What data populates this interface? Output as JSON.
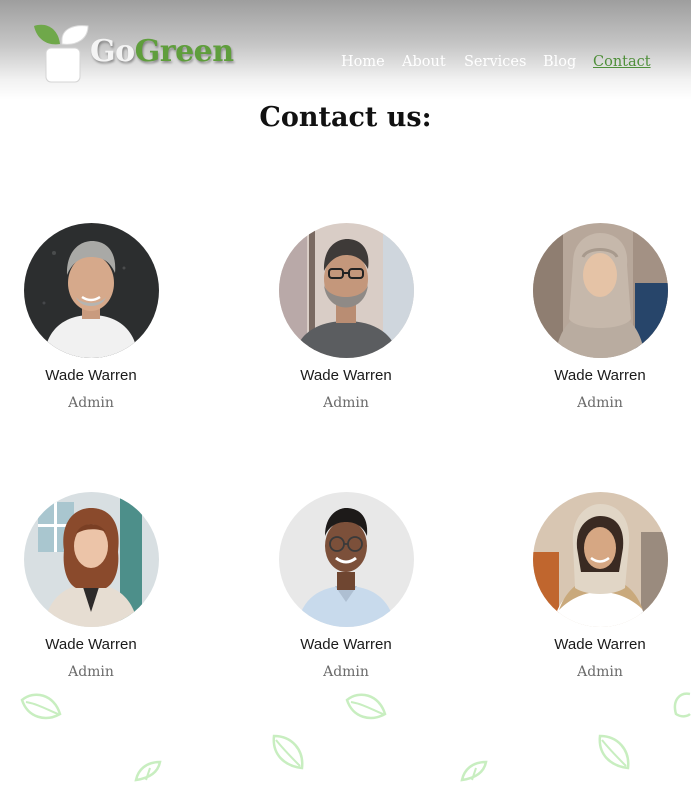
{
  "brand": {
    "name_part1": "Go",
    "name_part2": "Green"
  },
  "nav": {
    "items": [
      {
        "label": "Home",
        "active": false
      },
      {
        "label": "About",
        "active": false
      },
      {
        "label": "Services",
        "active": false
      },
      {
        "label": "Blog",
        "active": false
      },
      {
        "label": "Contact",
        "active": true
      }
    ]
  },
  "page": {
    "title": "Contact us:"
  },
  "team": [
    {
      "name": "Wade Warren",
      "role": "Admin",
      "avatar_icon": "person-photo-gray-hair-man"
    },
    {
      "name": "Wade Warren",
      "role": "Admin",
      "avatar_icon": "person-photo-bearded-man"
    },
    {
      "name": "Wade Warren",
      "role": "Admin",
      "avatar_icon": "person-photo-woman-hijab"
    },
    {
      "name": "Wade Warren",
      "role": "Admin",
      "avatar_icon": "person-photo-woman-red-hair"
    },
    {
      "name": "Wade Warren",
      "role": "Admin",
      "avatar_icon": "person-photo-man-glasses"
    },
    {
      "name": "Wade Warren",
      "role": "Admin",
      "avatar_icon": "person-photo-woman-scarf"
    }
  ],
  "colors": {
    "brand_green": "#5f9e3c",
    "nav_active": "#4f8f3a",
    "leaf_decoration": "#c8eec0"
  }
}
